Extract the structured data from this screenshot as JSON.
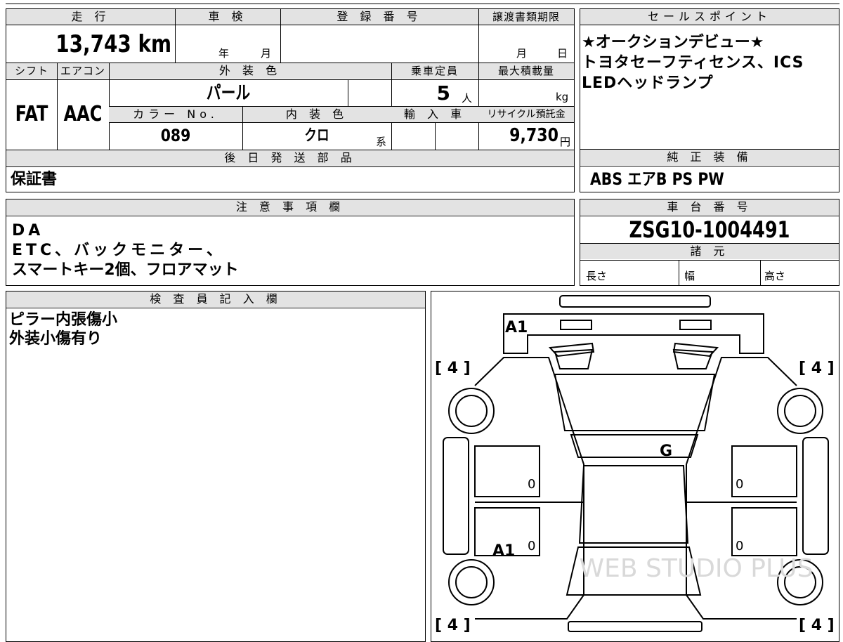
{
  "headers": {
    "mileage": "走 行",
    "inspection": "車 検",
    "registration": "登 録 番 号",
    "transfer_deadline": "譲渡書類期限",
    "sales_point": "セールスポイント",
    "shift": "シフト",
    "aircon": "エアコン",
    "exterior_color": "外 装 色",
    "capacity": "乗車定員",
    "max_load": "最大積載量",
    "color_no": "カラー No.",
    "interior_color": "内 装 色",
    "import_car": "輸 入 車",
    "recycle_fee": "リサイクル預託金",
    "deferred_parts": "後 日 発 送 部 品",
    "standard_equipment": "純 正 装 備",
    "notes": "注 意 事 項 欄",
    "chassis_number": "車 台 番 号",
    "specs": "諸 元",
    "inspector": "検 査 員 記 入 欄"
  },
  "values": {
    "mileage": "13,743 km",
    "inspection_year_unit": "年",
    "inspection_month_unit": "月",
    "transfer_month_unit": "月",
    "transfer_day_unit": "日",
    "shift": "FAT",
    "aircon": "AAC",
    "exterior_color": "パール",
    "capacity": "5",
    "capacity_unit": "人",
    "max_load_unit": "kg",
    "color_no": "089",
    "interior_color": "クロ",
    "interior_suffix": "系",
    "recycle_fee": "9,730",
    "recycle_unit": "円",
    "deferred_parts": "保証書",
    "standard_equipment": "ABS エアB PS PW",
    "chassis_number": "ZSG10-1004491",
    "spec_length": "長さ",
    "spec_width": "幅",
    "spec_height": "高さ"
  },
  "sales_points": [
    "★オークションデビュー★",
    "トヨタセーフティセンス、ICS",
    "LEDヘッドランプ"
  ],
  "notes_lines": [
    "DA",
    "ETC、バックモニター、",
    "スマートキー2個、フロアマット"
  ],
  "inspector_lines": [
    "ピラー内張傷小",
    "外装小傷有り"
  ],
  "diagram": {
    "marks": {
      "roof_a1": "A1",
      "rear_a1": "A1",
      "glass_g": "G",
      "front_left_tire": "[ 4 ]",
      "front_right_tire": "[ 4 ]",
      "rear_left_tire": "[ 4 ]",
      "rear_right_tire": "[ 4 ]",
      "door_fl": "0",
      "door_fr": "0",
      "door_rl": "0",
      "door_rr": "0"
    },
    "watermark": "WEB STUDIO PLUS"
  }
}
